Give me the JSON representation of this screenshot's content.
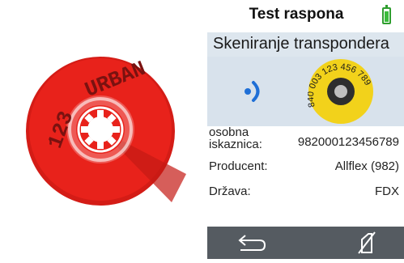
{
  "header": {
    "title": "Test raspona",
    "battery_level": 0.85,
    "battery_color": "#3cbb3c"
  },
  "scan": {
    "heading": "Skeniranje transpondera"
  },
  "tag": {
    "ring_text": "840 003 123 456 789",
    "color": "#f2d21b"
  },
  "coin": {
    "text_top": "URBAN",
    "text_left": "123",
    "color": "#e8221b"
  },
  "fields": [
    {
      "label": "osobna iskaznica:",
      "value": "982000123456789"
    },
    {
      "label": "Producent:",
      "value": "Allflex (982)"
    },
    {
      "label": "Država:",
      "value": "FDX"
    }
  ],
  "footer": {
    "back_icon": "back-arrow-icon",
    "right_icon": "no-scan-icon"
  }
}
